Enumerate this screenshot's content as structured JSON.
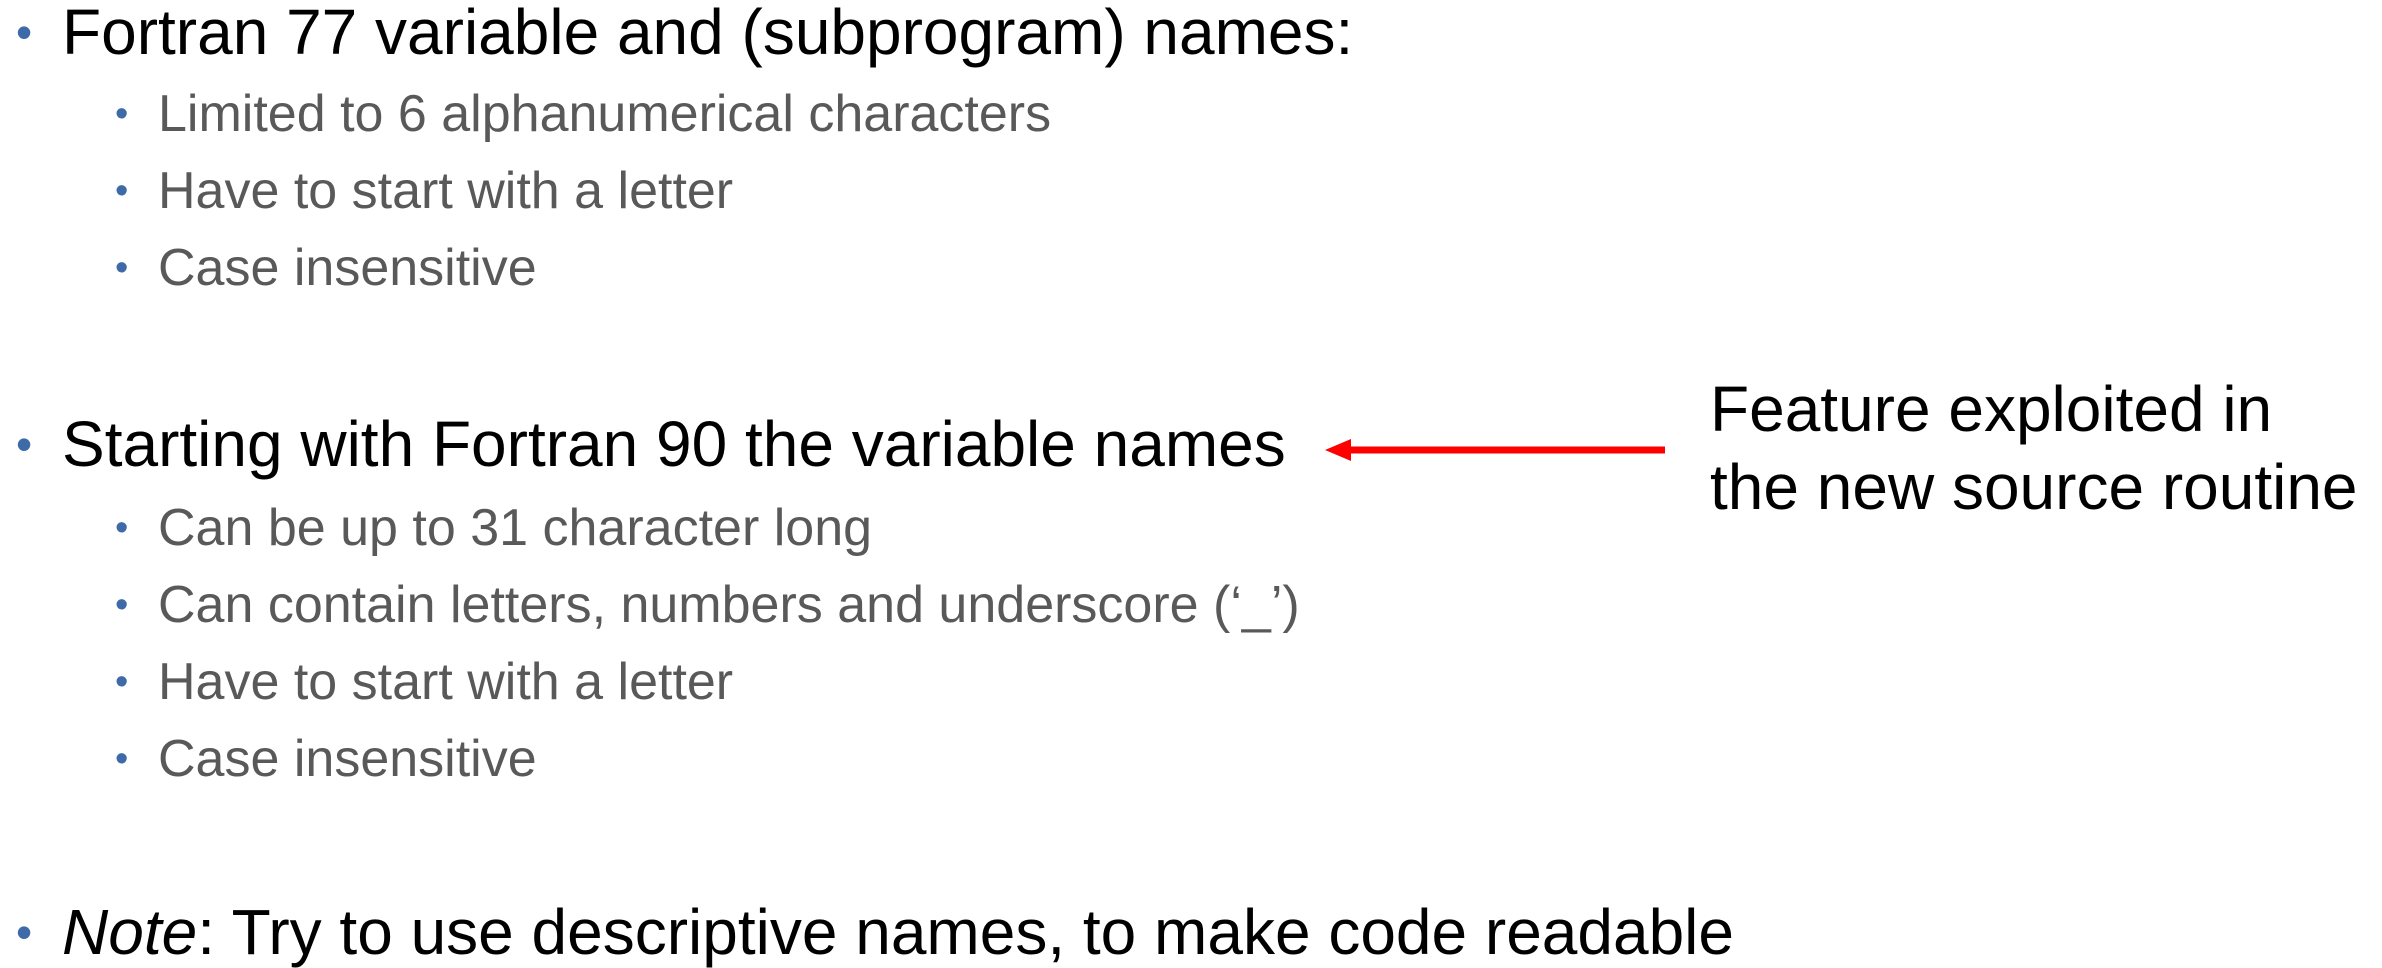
{
  "section1": {
    "heading": "Fortran 77 variable and (subprogram) names:",
    "items": [
      "Limited to 6 alphanumerical characters",
      "Have to start with a letter",
      "Case insensitive"
    ]
  },
  "section2": {
    "heading": "Starting with Fortran 90 the variable names",
    "items": [
      "Can be up to 31 character long",
      "Can contain letters, numbers and underscore (‘_’)",
      "Have to start with a letter",
      "Case insensitive"
    ]
  },
  "note": {
    "label": "Note",
    "text": ": Try to use descriptive names, to make code readable"
  },
  "callout": {
    "line1": "Feature exploited in",
    "line2": "the new source routine"
  },
  "colors": {
    "bullet": "#3e6aa8",
    "subtext": "#595959",
    "arrow": "#ff0000"
  }
}
